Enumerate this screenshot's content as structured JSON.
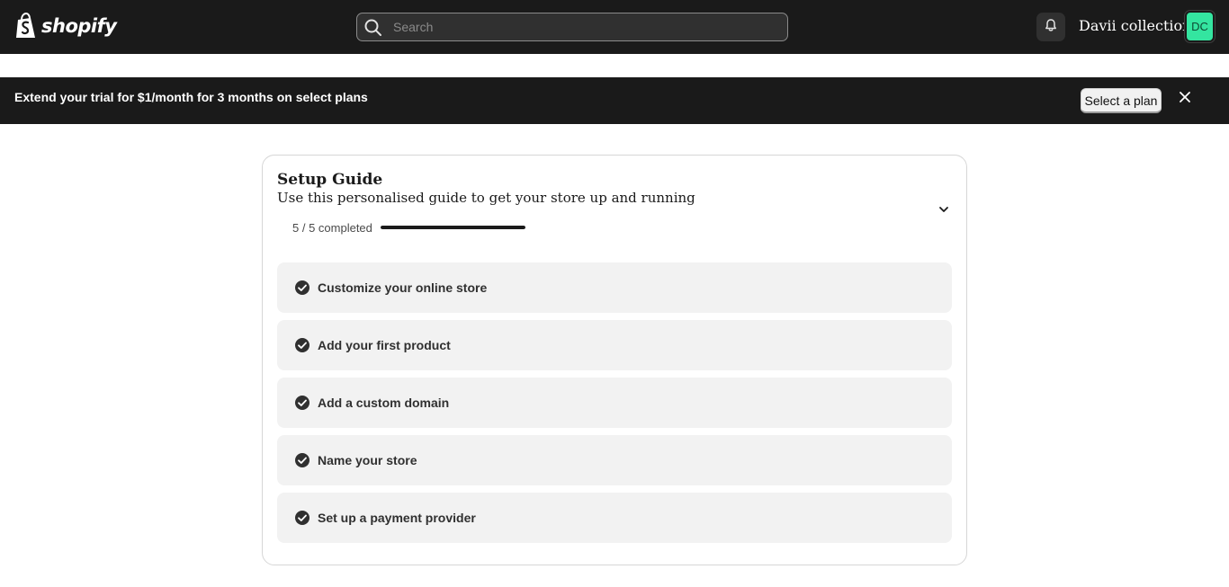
{
  "topbar": {
    "logo_text": "shopify",
    "search": {
      "placeholder": "Search",
      "value": ""
    },
    "store_name": "Davii collections",
    "avatar_initials": "DC",
    "icons": {
      "logo": "shopify-bag-icon",
      "search": "search-icon",
      "notifications": "bell-icon"
    },
    "colors": {
      "background": "#1a1a1a",
      "avatar": "#34e5a0"
    }
  },
  "banner": {
    "text": "Extend your trial for $1/month for 3 months on select plans",
    "button_label": "Select a plan",
    "close_icon": "close-icon"
  },
  "setup_guide": {
    "title": "Setup Guide",
    "subtitle": "Use this personalised guide to get your store up and running",
    "progress_text": "5 / 5 completed",
    "progress_fraction": 1.0,
    "collapse_icon": "chevron-down-icon",
    "tasks": [
      {
        "label": "Customize your online store",
        "done": true,
        "icon": "check-circle-icon"
      },
      {
        "label": "Add your first product",
        "done": true,
        "icon": "check-circle-icon"
      },
      {
        "label": "Add a custom domain",
        "done": true,
        "icon": "check-circle-icon"
      },
      {
        "label": "Name your store",
        "done": true,
        "icon": "check-circle-icon"
      },
      {
        "label": "Set up a payment provider",
        "done": true,
        "icon": "check-circle-icon"
      }
    ]
  }
}
